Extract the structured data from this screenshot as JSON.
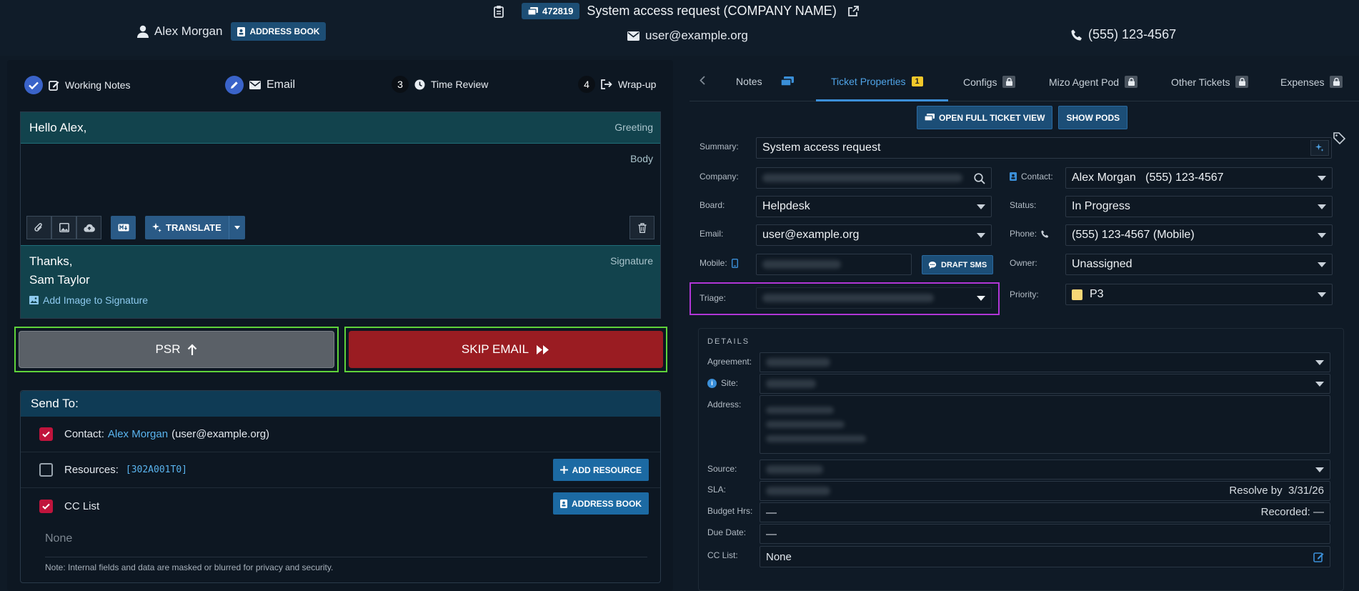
{
  "header": {
    "ticket_number": "472819",
    "title": "System access request (COMPANY NAME)",
    "user_name": "Alex Morgan",
    "address_book_label": "ADDRESS BOOK",
    "email": "user@example.org",
    "phone": "(555) 123-4567"
  },
  "steps": {
    "working_notes": "Working Notes",
    "email": "Email",
    "time_review_num": "3",
    "time_review": "Time Review",
    "wrap_up_num": "4",
    "wrap_up": "Wrap-up"
  },
  "composer": {
    "greeting_text": "Hello Alex,",
    "greeting_tag": "Greeting",
    "body_tag": "Body",
    "translate_label": "TRANSLATE",
    "signature_line1": "Thanks,",
    "signature_line2": "Sam Taylor",
    "signature_tag": "Signature",
    "add_image_label": "Add Image to Signature"
  },
  "actions": {
    "psr_label": "PSR",
    "skip_label": "SKIP EMAIL"
  },
  "send_to": {
    "heading": "Send To:",
    "contact_prefix": "Contact:",
    "contact_name": "Alex Morgan",
    "contact_email": "(user@example.org)",
    "resources_label": "Resources:",
    "resources_code": "[302A001T0]",
    "add_resource_label": "ADD RESOURCE",
    "cc_label": "CC List",
    "address_book_label": "ADDRESS BOOK",
    "cc_none": "None",
    "note": "Note: Internal fields and data are masked or blurred for privacy and security.",
    "contact_checked": true,
    "resources_checked": false,
    "cc_checked": true
  },
  "tabs": [
    {
      "label": "Notes"
    },
    {
      "label": "Ticket Properties",
      "badge": "1"
    },
    {
      "label": "Configs"
    },
    {
      "label": "Mizo Agent Pod"
    },
    {
      "label": "Other Tickets"
    },
    {
      "label": "Expenses"
    }
  ],
  "props": {
    "open_full_label": "OPEN FULL TICKET VIEW",
    "show_pods_label": "SHOW PODS",
    "summary_label": "Summary:",
    "summary_value": "System access request",
    "company_label": "Company:",
    "contact_label": "Contact:",
    "contact_value": "Alex Morgan   (555) 123-4567",
    "board_label": "Board:",
    "board_value": "Helpdesk",
    "status_label": "Status:",
    "status_value": "In Progress",
    "email_label": "Email:",
    "email_value": "user@example.org",
    "phone_label": "Phone:",
    "phone_value": "(555) 123-4567 (Mobile)",
    "mobile_label": "Mobile:",
    "draft_sms_label": "DRAFT SMS",
    "owner_label": "Owner:",
    "owner_value": "Unassigned",
    "triage_label": "Triage:",
    "priority_label": "Priority:",
    "priority_value": "P3",
    "priority_color": "#f6d776"
  },
  "details": {
    "title": "DETAILS",
    "agreement_label": "Agreement:",
    "site_label": "Site:",
    "address_label": "Address:",
    "source_label": "Source:",
    "sla_label": "SLA:",
    "sla_resolve": "Resolve by  3/31/26",
    "budget_label": "Budget Hrs:",
    "budget_value": "—",
    "recorded": "Recorded: —",
    "due_label": "Due Date:",
    "due_value": "—",
    "cc_label": "CC List:",
    "cc_value": "None"
  },
  "colors": {
    "accent": "#3c8fd8",
    "skip": "#9a1c22",
    "highlight_green": "#5fd33a",
    "highlight_purple": "#b036d6"
  }
}
